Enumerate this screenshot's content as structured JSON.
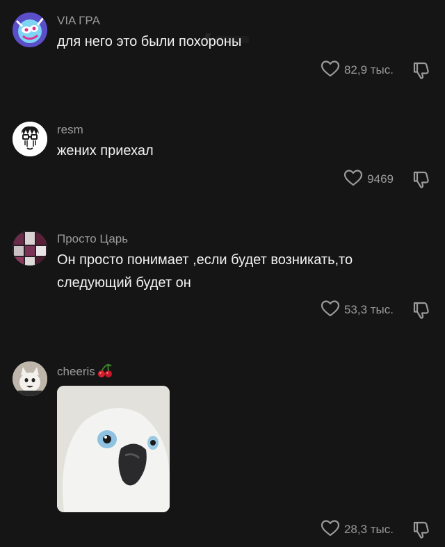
{
  "comments": [
    {
      "username": "VIA ГРА",
      "text": "для него это были похороны",
      "likes": "82,9 тыс."
    },
    {
      "username": "resm",
      "text": "жених приехал",
      "likes": "9469"
    },
    {
      "username": "Просто Царь",
      "text": "Он просто понимает ,если будет возникать,то следующий будет он",
      "likes": "53,3 тыс."
    },
    {
      "username": "cheeris",
      "username_emoji": "cherry-icon",
      "text": "",
      "likes": "28,3 тыс."
    }
  ],
  "colors": {
    "background": "#151515",
    "meta": "#9a9a9a",
    "text": "#f2f2f2"
  }
}
